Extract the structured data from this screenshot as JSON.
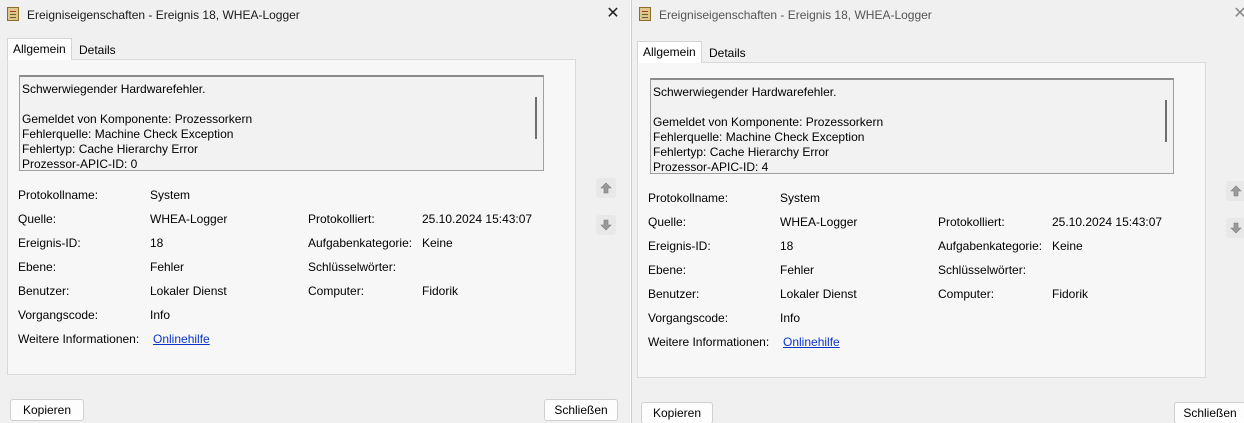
{
  "window1": {
    "title": "Ereigniseigenschaften - Ereignis 18, WHEA-Logger",
    "close_glyph": "✕",
    "tabs": [
      "Allgemein",
      "Details"
    ],
    "description_lines": [
      "Schwerwiegender Hardwarefehler.",
      "Gemeldet von Komponente: Prozessorkern",
      "Fehlerquelle: Machine Check Exception",
      "Fehlertyp: Cache Hierarchy Error",
      "Prozessor-APIC-ID: 0"
    ],
    "fields": {
      "protokollname": {
        "label": "Protokollname:",
        "value": "System"
      },
      "quelle": {
        "label": "Quelle:",
        "value": "WHEA-Logger"
      },
      "protokolliert": {
        "label": "Protokolliert:",
        "value": "25.10.2024 15:43:07"
      },
      "ereignis_id": {
        "label": "Ereignis-ID:",
        "value": "18"
      },
      "aufgabenkategorie": {
        "label": "Aufgabenkategorie:",
        "value": "Keine"
      },
      "ebene": {
        "label": "Ebene:",
        "value": "Fehler"
      },
      "schluesselwoerter": {
        "label": "Schlüsselwörter:",
        "value": ""
      },
      "benutzer": {
        "label": "Benutzer:",
        "value": "Lokaler Dienst"
      },
      "computer": {
        "label": "Computer:",
        "value": "Fidorik"
      },
      "vorgangscode": {
        "label": "Vorgangscode:",
        "value": "Info"
      },
      "weitere": {
        "label": "Weitere Informationen:",
        "value": "Onlinehilfe"
      }
    },
    "buttons": {
      "copy": "Kopieren",
      "close": "Schließen"
    }
  },
  "window2": {
    "title": "Ereigniseigenschaften - Ereignis 18, WHEA-Logger",
    "close_glyph": "✕",
    "tabs": [
      "Allgemein",
      "Details"
    ],
    "description_lines": [
      "Schwerwiegender Hardwarefehler.",
      "Gemeldet von Komponente: Prozessorkern",
      "Fehlerquelle: Machine Check Exception",
      "Fehlertyp: Cache Hierarchy Error",
      "Prozessor-APIC-ID: 4"
    ],
    "fields": {
      "protokollname": {
        "label": "Protokollname:",
        "value": "System"
      },
      "quelle": {
        "label": "Quelle:",
        "value": "WHEA-Logger"
      },
      "protokolliert": {
        "label": "Protokolliert:",
        "value": "25.10.2024 15:43:07"
      },
      "ereignis_id": {
        "label": "Ereignis-ID:",
        "value": "18"
      },
      "aufgabenkategorie": {
        "label": "Aufgabenkategorie:",
        "value": "Keine"
      },
      "ebene": {
        "label": "Ebene:",
        "value": "Fehler"
      },
      "schluesselwoerter": {
        "label": "Schlüsselwörter:",
        "value": ""
      },
      "benutzer": {
        "label": "Benutzer:",
        "value": "Lokaler Dienst"
      },
      "computer": {
        "label": "Computer:",
        "value": "Fidorik"
      },
      "vorgangscode": {
        "label": "Vorgangscode:",
        "value": "Info"
      },
      "weitere": {
        "label": "Weitere Informationen:",
        "value": "Onlinehilfe"
      }
    },
    "buttons": {
      "copy": "Kopieren",
      "close": "Schließen"
    }
  },
  "icons": {
    "app": "event-viewer-icon",
    "up": "arrow-up-icon",
    "down": "arrow-down-icon",
    "close": "close-icon"
  },
  "colors": {
    "link": "#0a34c8",
    "background": "#f0f0f0"
  }
}
